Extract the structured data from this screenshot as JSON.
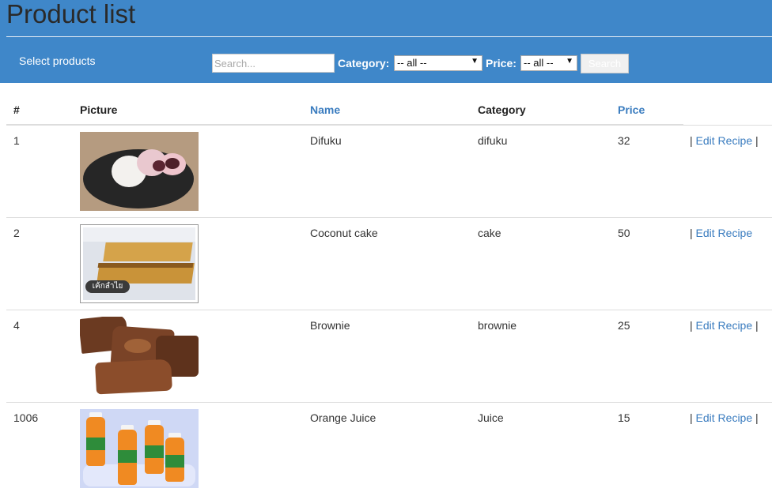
{
  "page": {
    "title": "Product list",
    "subtitle": "Select products"
  },
  "filters": {
    "search_placeholder": "Search...",
    "category_label": "Category:",
    "category_value": "-- all --",
    "price_label": "Price:",
    "price_value": "-- all --",
    "search_button": "Search"
  },
  "table": {
    "headers": {
      "id": "#",
      "picture": "Picture",
      "name": "Name",
      "category": "Category",
      "price": "Price"
    },
    "rows": [
      {
        "id": "1",
        "name": "Difuku",
        "category": "difuku",
        "price": "32",
        "picture": "difuku-photo"
      },
      {
        "id": "2",
        "name": "Coconut cake",
        "category": "cake",
        "price": "50",
        "picture": "coconut-cake-photo",
        "picture_text": "เค้กลำไย"
      },
      {
        "id": "4",
        "name": "Brownie",
        "category": "brownie",
        "price": "25",
        "picture": "brownie-photo"
      },
      {
        "id": "1006",
        "name": "Orange Juice",
        "category": "Juice",
        "price": "15",
        "picture": "orange-juice-photo"
      }
    ],
    "action_label": "Edit Recipe",
    "action_separator": "|"
  },
  "colors": {
    "header_bg": "#3f87c9",
    "link": "#3a7cbf"
  }
}
